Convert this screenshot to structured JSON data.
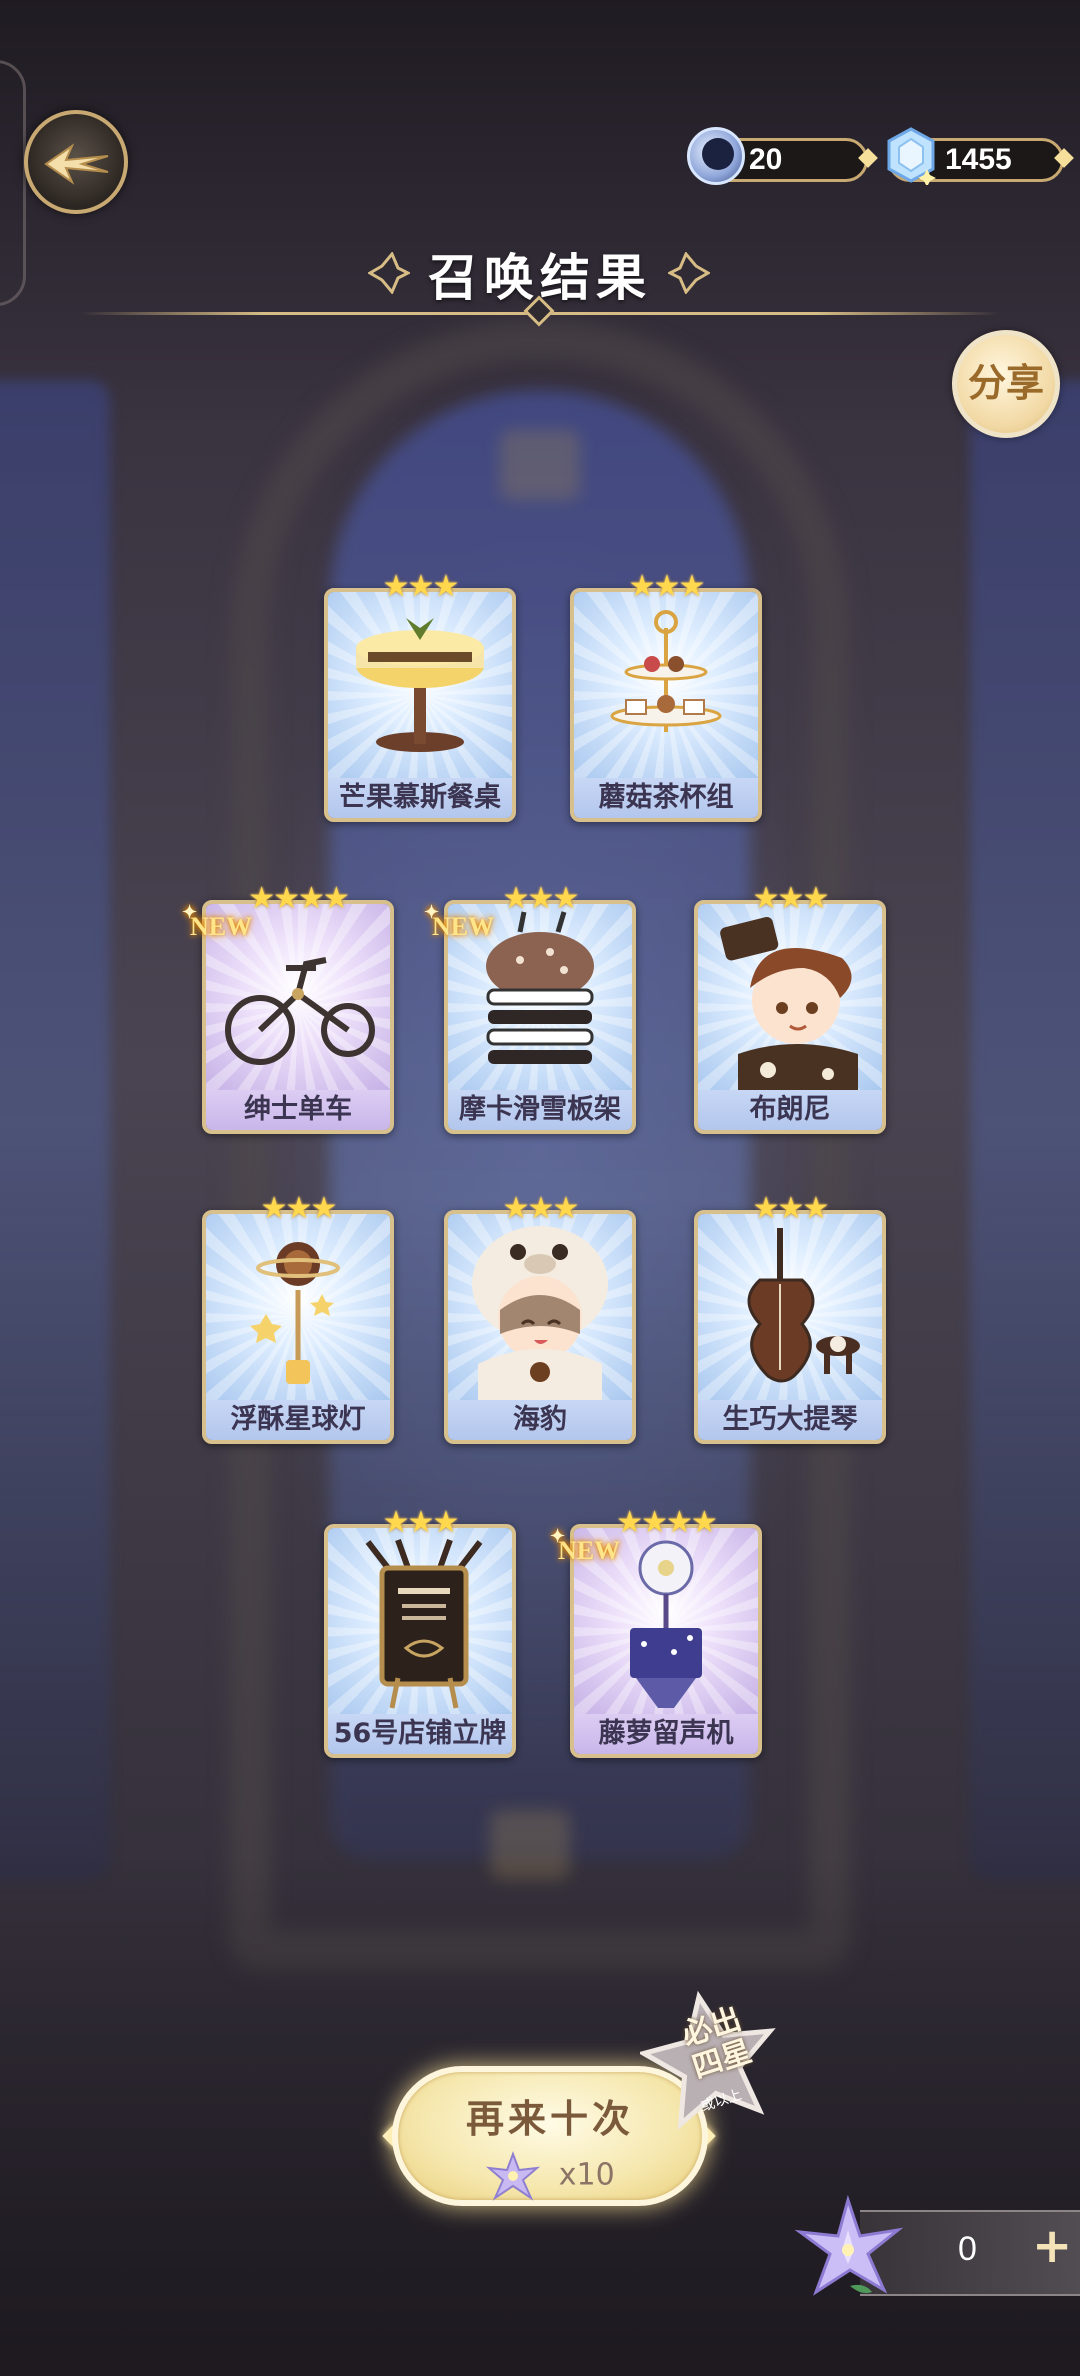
{
  "header": {
    "title": "召唤结果",
    "share_label": "分享",
    "currency_moon": "20",
    "currency_gem": "1455"
  },
  "cards": [
    {
      "name": "芒果慕斯餐桌",
      "stars": "★★★",
      "new": false,
      "rarity": "blue",
      "icon": "mousse-table-icon"
    },
    {
      "name": "蘑菇茶杯组",
      "stars": "★★★",
      "new": false,
      "rarity": "blue",
      "icon": "tea-stand-icon"
    },
    {
      "name": "绅士单车",
      "stars": "★★★★",
      "new": true,
      "new_label": "NEW",
      "rarity": "purple",
      "icon": "bicycle-icon"
    },
    {
      "name": "摩卡滑雪板架",
      "stars": "★★★",
      "new": true,
      "new_label": "NEW",
      "rarity": "blue",
      "icon": "ski-rack-icon"
    },
    {
      "name": "布朗尼",
      "stars": "★★★",
      "new": false,
      "rarity": "blue",
      "icon": "brownie-character-icon"
    },
    {
      "name": "浮酥星球灯",
      "stars": "★★★",
      "new": false,
      "rarity": "blue",
      "icon": "planet-lamp-icon"
    },
    {
      "name": "海豹",
      "stars": "★★★",
      "new": false,
      "rarity": "blue",
      "icon": "seal-character-icon"
    },
    {
      "name": "生巧大提琴",
      "stars": "★★★",
      "new": false,
      "rarity": "blue",
      "icon": "cello-icon"
    },
    {
      "name": "56号店铺立牌",
      "stars": "★★★",
      "new": false,
      "rarity": "blue",
      "icon": "shop-sign-icon"
    },
    {
      "name": "藤萝留声机",
      "stars": "★★★★",
      "new": true,
      "new_label": "NEW",
      "rarity": "purple",
      "icon": "gramophone-icon"
    }
  ],
  "footer": {
    "again_label": "再来十次",
    "again_cost": "x10",
    "guarantee_line1": "必出",
    "guarantee_line2": "四星",
    "guarantee_sub": "或以上",
    "item_count": "0",
    "plus_label": "+"
  }
}
